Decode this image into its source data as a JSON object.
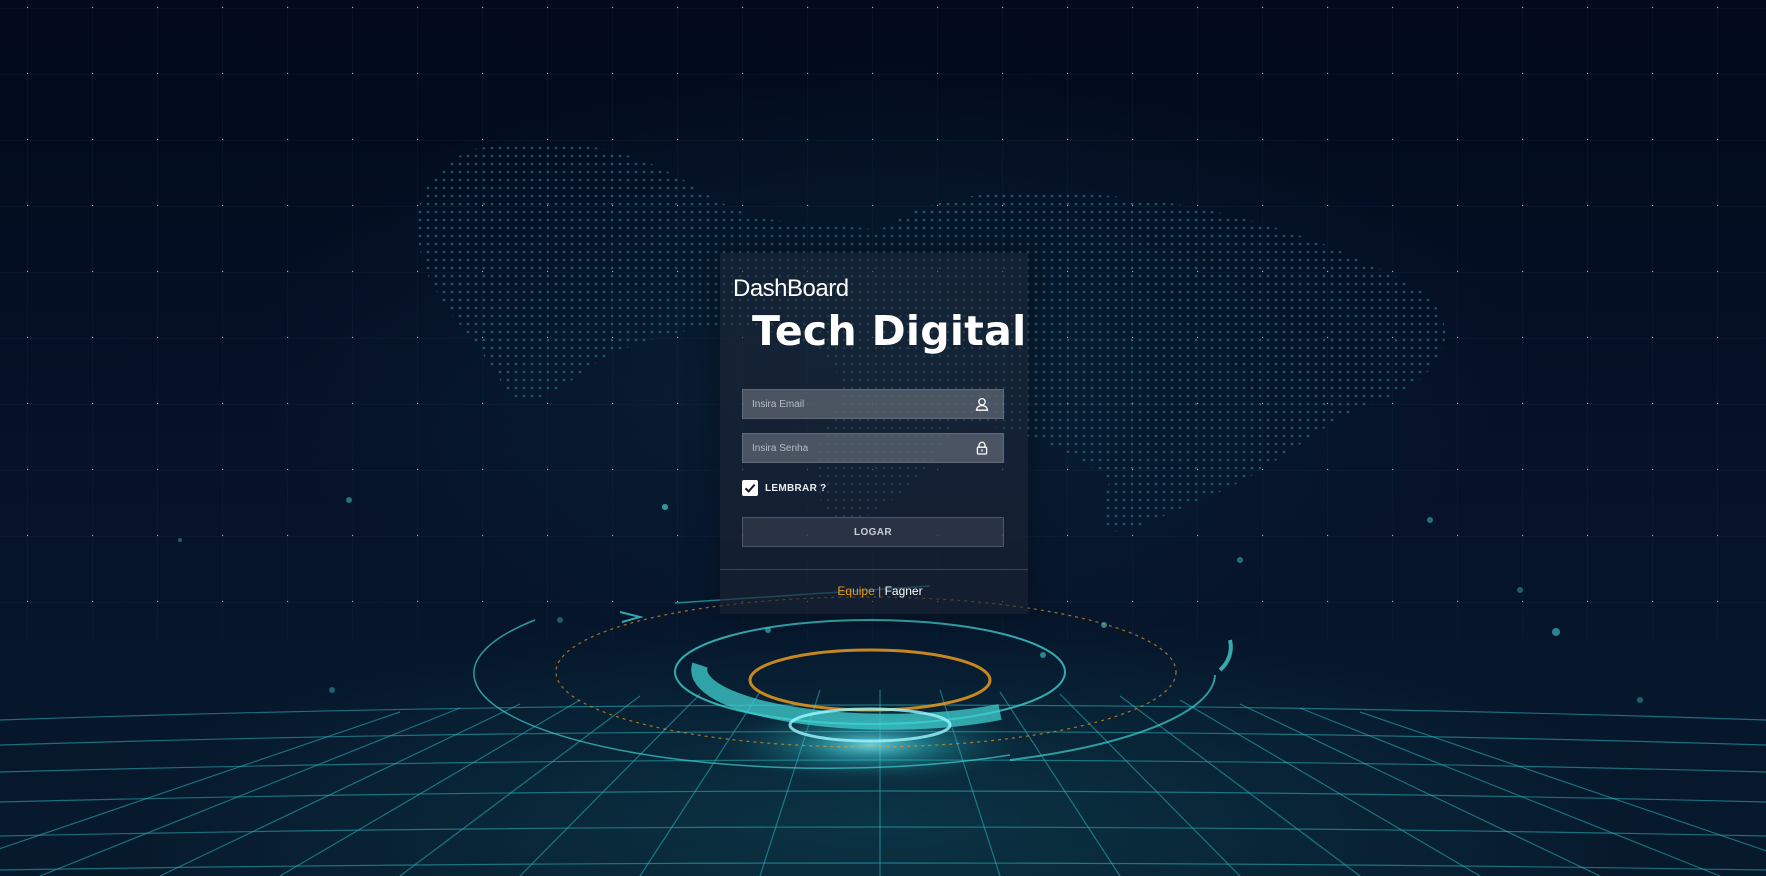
{
  "brand": {
    "small_title": "DashBoard",
    "large_title": "Tech Digital"
  },
  "form": {
    "email_placeholder": "Insira Email",
    "email_icon": "user-icon",
    "password_placeholder": "Insira Senha",
    "password_icon": "lock-icon",
    "remember_label": "LEMBRAR ?",
    "remember_checked": true,
    "submit_label": "LOGAR"
  },
  "footer": {
    "team_label": "Equipe",
    "separator": "|",
    "author": "Fagner"
  },
  "colors": {
    "background": "#030b1c",
    "accent_cyan": "#3fd0d0",
    "accent_orange": "#e89a1e",
    "card": "#1e283a"
  }
}
